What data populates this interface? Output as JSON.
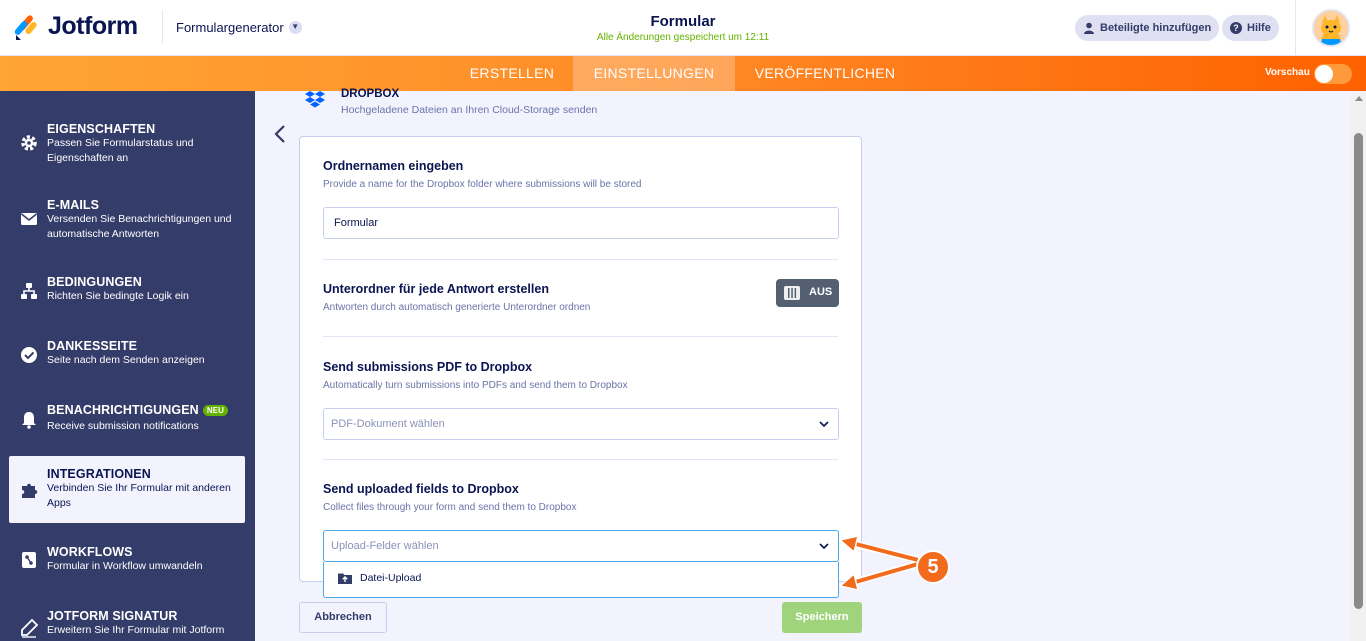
{
  "header": {
    "brand": "Jotform",
    "form_generator": "Formulargenerator",
    "form_title": "Formular",
    "save_status": "Alle Änderungen gespeichert um 12:11",
    "add_participants": "Beteiligte hinzufügen",
    "help": "Hilfe"
  },
  "nav": {
    "tabs": [
      {
        "label": "ERSTELLEN"
      },
      {
        "label": "EINSTELLUNGEN"
      },
      {
        "label": "VERÖFFENTLICHEN"
      }
    ],
    "active_tab": "EINSTELLUNGEN",
    "preview_label": "Vorschau",
    "preview_on": false
  },
  "sidebar": {
    "items": [
      {
        "title": "EIGENSCHAFTEN",
        "desc": "Passen Sie Formularstatus und Eigenschaften an",
        "icon": "gear-icon"
      },
      {
        "title": "E-MAILS",
        "desc": "Versenden Sie Benachrichtigungen und automatische Antworten",
        "icon": "envelope-icon"
      },
      {
        "title": "BEDINGUNGEN",
        "desc": "Richten Sie bedingte Logik ein",
        "icon": "branch-icon"
      },
      {
        "title": "DANKESSEITE",
        "desc": "Seite nach dem Senden anzeigen",
        "icon": "check-circle-icon"
      },
      {
        "title": "BENACHRICHTIGUNGEN",
        "badge": "NEU",
        "desc": "Receive submission notifications",
        "icon": "bell-icon"
      },
      {
        "title": "INTEGRATIONEN",
        "desc": "Verbinden Sie Ihr Formular mit anderen Apps",
        "icon": "puzzle-icon"
      },
      {
        "title": "WORKFLOWS",
        "desc": "Formular in Workflow umwandeln",
        "icon": "workflow-icon"
      },
      {
        "title": "JOTFORM SIGNATUR",
        "desc": "Erweitern Sie Ihr Formular mit Jotform",
        "icon": "pen-icon"
      }
    ],
    "active_item": "INTEGRATIONEN"
  },
  "integration": {
    "title": "DROPBOX",
    "subtitle": "Hochgeladene Dateien an Ihren Cloud-Storage senden"
  },
  "form": {
    "folder_label": "Ordnernamen eingeben",
    "folder_desc": "Provide a name for the Dropbox folder where submissions will be stored",
    "folder_value": "Formular",
    "subfolder_label": "Unterordner für jede Antwort erstellen",
    "subfolder_desc": "Antworten durch automatisch generierte Unterordner ordnen",
    "subfolder_toggle": "AUS",
    "pdf_label": "Send submissions PDF to Dropbox",
    "pdf_desc": "Automatically turn submissions into PDFs and send them to Dropbox",
    "pdf_placeholder": "PDF-Dokument wählen",
    "upload_label": "Send uploaded fields to Dropbox",
    "upload_desc": "Collect files through your form and send them to Dropbox",
    "upload_placeholder": "Upload-Felder wählen",
    "upload_options": [
      "Datei-Upload"
    ]
  },
  "buttons": {
    "cancel": "Abbrechen",
    "save": "Speichern"
  },
  "annotation": {
    "step_number": "5",
    "color": "#f26a1b"
  }
}
